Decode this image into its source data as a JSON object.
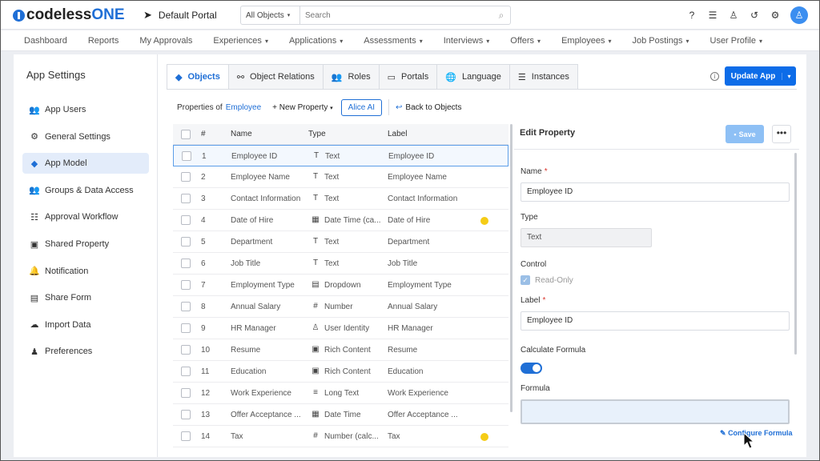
{
  "header": {
    "logo_prefix": "codeless",
    "logo_suffix": "ONE",
    "portal_name": "Default Portal",
    "search_scope": "All Objects",
    "search_placeholder": "Search"
  },
  "nav": [
    "Dashboard",
    "Reports",
    "My Approvals",
    "Experiences",
    "Applications",
    "Assessments",
    "Interviews",
    "Offers",
    "Employees",
    "Job Postings",
    "User Profile"
  ],
  "nav_dropdown": [
    false,
    false,
    false,
    true,
    true,
    true,
    true,
    true,
    true,
    true,
    true
  ],
  "sidebar": {
    "title": "App Settings",
    "items": [
      {
        "label": "App Users",
        "icon": "users-icon",
        "glyph": "👥",
        "active": false
      },
      {
        "label": "General Settings",
        "icon": "gear-icon",
        "glyph": "⚙",
        "active": false
      },
      {
        "label": "App Model",
        "icon": "cube-icon",
        "glyph": "◆",
        "active": true
      },
      {
        "label": "Groups & Data Access",
        "icon": "group-icon",
        "glyph": "👥",
        "active": false
      },
      {
        "label": "Approval Workflow",
        "icon": "checklist-icon",
        "glyph": "☷",
        "active": false
      },
      {
        "label": "Shared Property",
        "icon": "shared-box-icon",
        "glyph": "▣",
        "active": false
      },
      {
        "label": "Notification",
        "icon": "bell-icon",
        "glyph": "🔔",
        "active": false
      },
      {
        "label": "Share Form",
        "icon": "form-icon",
        "glyph": "▤",
        "active": false
      },
      {
        "label": "Import Data",
        "icon": "cloud-upload-icon",
        "glyph": "☁",
        "active": false
      },
      {
        "label": "Preferences",
        "icon": "user-settings-icon",
        "glyph": "♟",
        "active": false
      }
    ]
  },
  "tabs": [
    {
      "label": "Objects",
      "icon": "cube-icon",
      "glyph": "◆",
      "active": true
    },
    {
      "label": "Object Relations",
      "icon": "relations-icon",
      "glyph": "⚯",
      "active": false
    },
    {
      "label": "Roles",
      "icon": "roles-icon",
      "glyph": "👥",
      "active": false
    },
    {
      "label": "Portals",
      "icon": "monitor-icon",
      "glyph": "▭",
      "active": false
    },
    {
      "label": "Language",
      "icon": "globe-icon",
      "glyph": "🌐",
      "active": false
    },
    {
      "label": "Instances",
      "icon": "database-icon",
      "glyph": "☰",
      "active": false
    }
  ],
  "update_button": "Update App",
  "subbar": {
    "properties_of": "Properties of",
    "object_name": "Employee",
    "new_property": "+ New Property",
    "alice_ai": "Alice AI",
    "back": "Back to Objects"
  },
  "table": {
    "headers": {
      "num": "#",
      "name": "Name",
      "type": "Type",
      "label": "Label"
    },
    "rows": [
      {
        "num": "1",
        "name": "Employee ID",
        "type_icon": "T",
        "type": "Text",
        "label": "Employee ID",
        "flag": false,
        "selected": true
      },
      {
        "num": "2",
        "name": "Employee Name",
        "type_icon": "T",
        "type": "Text",
        "label": "Employee Name",
        "flag": false,
        "selected": false
      },
      {
        "num": "3",
        "name": "Contact Information",
        "type_icon": "T",
        "type": "Text",
        "label": "Contact Information",
        "flag": false,
        "selected": false
      },
      {
        "num": "4",
        "name": "Date of Hire",
        "type_icon": "▦",
        "type": "Date Time (ca...",
        "label": "Date of Hire",
        "flag": true,
        "selected": false
      },
      {
        "num": "5",
        "name": "Department",
        "type_icon": "T",
        "type": "Text",
        "label": "Department",
        "flag": false,
        "selected": false
      },
      {
        "num": "6",
        "name": "Job Title",
        "type_icon": "T",
        "type": "Text",
        "label": "Job Title",
        "flag": false,
        "selected": false
      },
      {
        "num": "7",
        "name": "Employment Type",
        "type_icon": "▤",
        "type": "Dropdown",
        "label": "Employment Type",
        "flag": false,
        "selected": false
      },
      {
        "num": "8",
        "name": "Annual Salary",
        "type_icon": "#",
        "type": "Number",
        "label": "Annual Salary",
        "flag": false,
        "selected": false
      },
      {
        "num": "9",
        "name": "HR Manager",
        "type_icon": "♙",
        "type": "User Identity",
        "label": "HR Manager",
        "flag": false,
        "selected": false
      },
      {
        "num": "10",
        "name": "Resume",
        "type_icon": "▣",
        "type": "Rich Content",
        "label": "Resume",
        "flag": false,
        "selected": false
      },
      {
        "num": "11",
        "name": "Education",
        "type_icon": "▣",
        "type": "Rich Content",
        "label": "Education",
        "flag": false,
        "selected": false
      },
      {
        "num": "12",
        "name": "Work Experience",
        "type_icon": "≡",
        "type": "Long Text",
        "label": "Work Experience",
        "flag": false,
        "selected": false
      },
      {
        "num": "13",
        "name": "Offer Acceptance ...",
        "type_icon": "▦",
        "type": "Date Time",
        "label": "Offer Acceptance ...",
        "flag": false,
        "selected": false
      },
      {
        "num": "14",
        "name": "Tax",
        "type_icon": "#",
        "type": "Number (calc...",
        "label": "Tax",
        "flag": true,
        "selected": false
      }
    ]
  },
  "edit_panel": {
    "title": "Edit Property",
    "save": "Save",
    "name_label": "Name",
    "name_value": "Employee ID",
    "type_label": "Type",
    "type_value": "Text",
    "control_label": "Control",
    "readonly_label": "Read-Only",
    "readonly_checked": true,
    "label_label": "Label",
    "label_value": "Employee ID",
    "calc_label": "Calculate Formula",
    "calc_on": true,
    "formula_label": "Formula",
    "formula_value": "",
    "configure": "Configure Formula"
  },
  "colors": {
    "accent": "#1f6fd6",
    "button": "#0d6ce8",
    "flag": "#f5cc16",
    "active_bg": "#e3ecfa"
  }
}
